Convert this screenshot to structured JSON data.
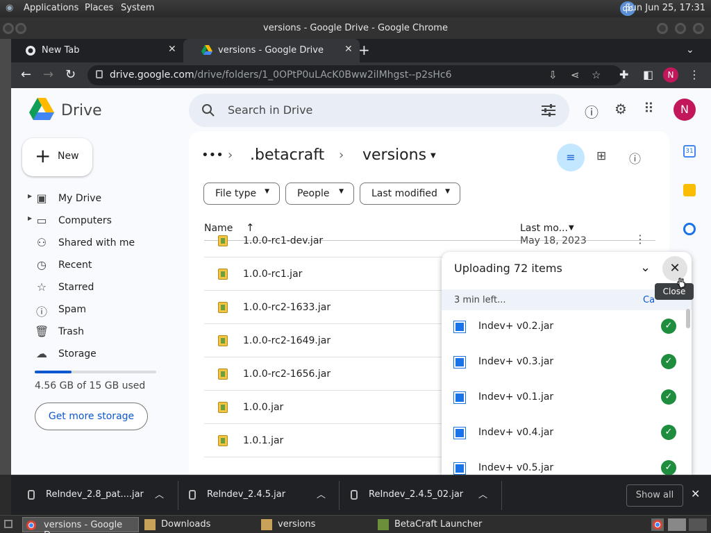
{
  "os": {
    "menus": [
      "Applications",
      "Places",
      "System"
    ],
    "tray_badge": "qb",
    "clock": "Sun Jun 25, 17:31"
  },
  "window": {
    "title": "versions - Google Drive - Google Chrome"
  },
  "tabs": [
    {
      "label": "New Tab"
    },
    {
      "label": "versions - Google Drive"
    }
  ],
  "address": {
    "domain": "drive.google.com",
    "path": "/drive/folders/1_0OPtP0uLAcK0Bww2ilMhgst--p2sHc6",
    "profile": "N"
  },
  "drive": {
    "app_name": "Drive",
    "search_placeholder": "Search in Drive",
    "avatar": "N",
    "new_label": "New",
    "nav": [
      {
        "label": "My Drive",
        "icon": "my-drive-icon"
      },
      {
        "label": "Computers",
        "icon": "computers-icon"
      },
      {
        "label": "Shared with me",
        "icon": "shared-icon"
      },
      {
        "label": "Recent",
        "icon": "clock-icon"
      },
      {
        "label": "Starred",
        "icon": "star-icon"
      },
      {
        "label": "Spam",
        "icon": "spam-icon"
      },
      {
        "label": "Trash",
        "icon": "trash-icon"
      },
      {
        "label": "Storage",
        "icon": "cloud-icon"
      }
    ],
    "storage_text": "4.56 GB of 15 GB used",
    "storage_fraction": 0.304,
    "more_storage": "Get more storage",
    "breadcrumb": {
      "parent": ".betacraft",
      "current": "versions"
    },
    "filters": [
      "File type",
      "People",
      "Last modified"
    ],
    "columns": {
      "name": "Name",
      "modified": "Last mo..."
    },
    "files": [
      {
        "name": "1.0.0-rc1-dev.jar",
        "date": "May 18, 2023"
      },
      {
        "name": "1.0.0-rc1.jar",
        "date": ""
      },
      {
        "name": "1.0.0-rc2-1633.jar",
        "date": ""
      },
      {
        "name": "1.0.0-rc2-1649.jar",
        "date": ""
      },
      {
        "name": "1.0.0-rc2-1656.jar",
        "date": ""
      },
      {
        "name": "1.0.0.jar",
        "date": ""
      },
      {
        "name": "1.0.1.jar",
        "date": ""
      }
    ]
  },
  "upload": {
    "title": "Uploading 72 items",
    "status": "3 min left...",
    "cancel": "Ca",
    "tooltip": "Close",
    "items": [
      {
        "name": "Indev+ v0.2.jar"
      },
      {
        "name": "Indev+ v0.3.jar"
      },
      {
        "name": "Indev+ v0.1.jar"
      },
      {
        "name": "Indev+ v0.4.jar"
      },
      {
        "name": "Indev+ v0.5.jar"
      }
    ]
  },
  "downloads": {
    "items": [
      {
        "name": "ReIndev_2.8_pat....jar"
      },
      {
        "name": "ReIndev_2.4.5.jar"
      },
      {
        "name": "ReIndev_2.4.5_02.jar"
      }
    ],
    "show_all": "Show all"
  },
  "taskbar": [
    {
      "label": "versions - Google D..."
    },
    {
      "label": "Downloads"
    },
    {
      "label": "versions"
    },
    {
      "label": "BetaCraft Launcher ..."
    }
  ]
}
